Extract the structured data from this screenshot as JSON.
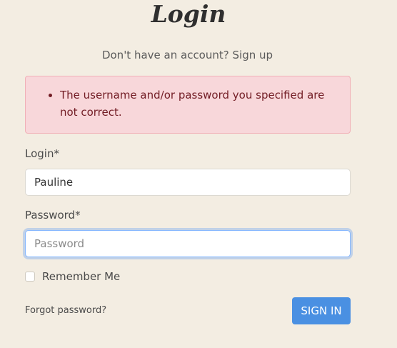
{
  "page": {
    "title": "Login",
    "signup_prompt": "Don't have an account?",
    "signup_link": "Sign up"
  },
  "alert": {
    "messages": [
      "The username and/or password you specified are not correct."
    ]
  },
  "form": {
    "login_label": "Login*",
    "login_value": "Pauline",
    "password_label": "Password*",
    "password_placeholder": "Password",
    "remember_label": "Remember Me",
    "remember_checked": false,
    "forgot_link": "Forgot password?",
    "submit_label": "SIGN IN"
  },
  "colors": {
    "background": "#f3ede2",
    "alert_bg": "#f8d7da",
    "alert_text": "#721c24",
    "primary": "#4a90e2"
  }
}
